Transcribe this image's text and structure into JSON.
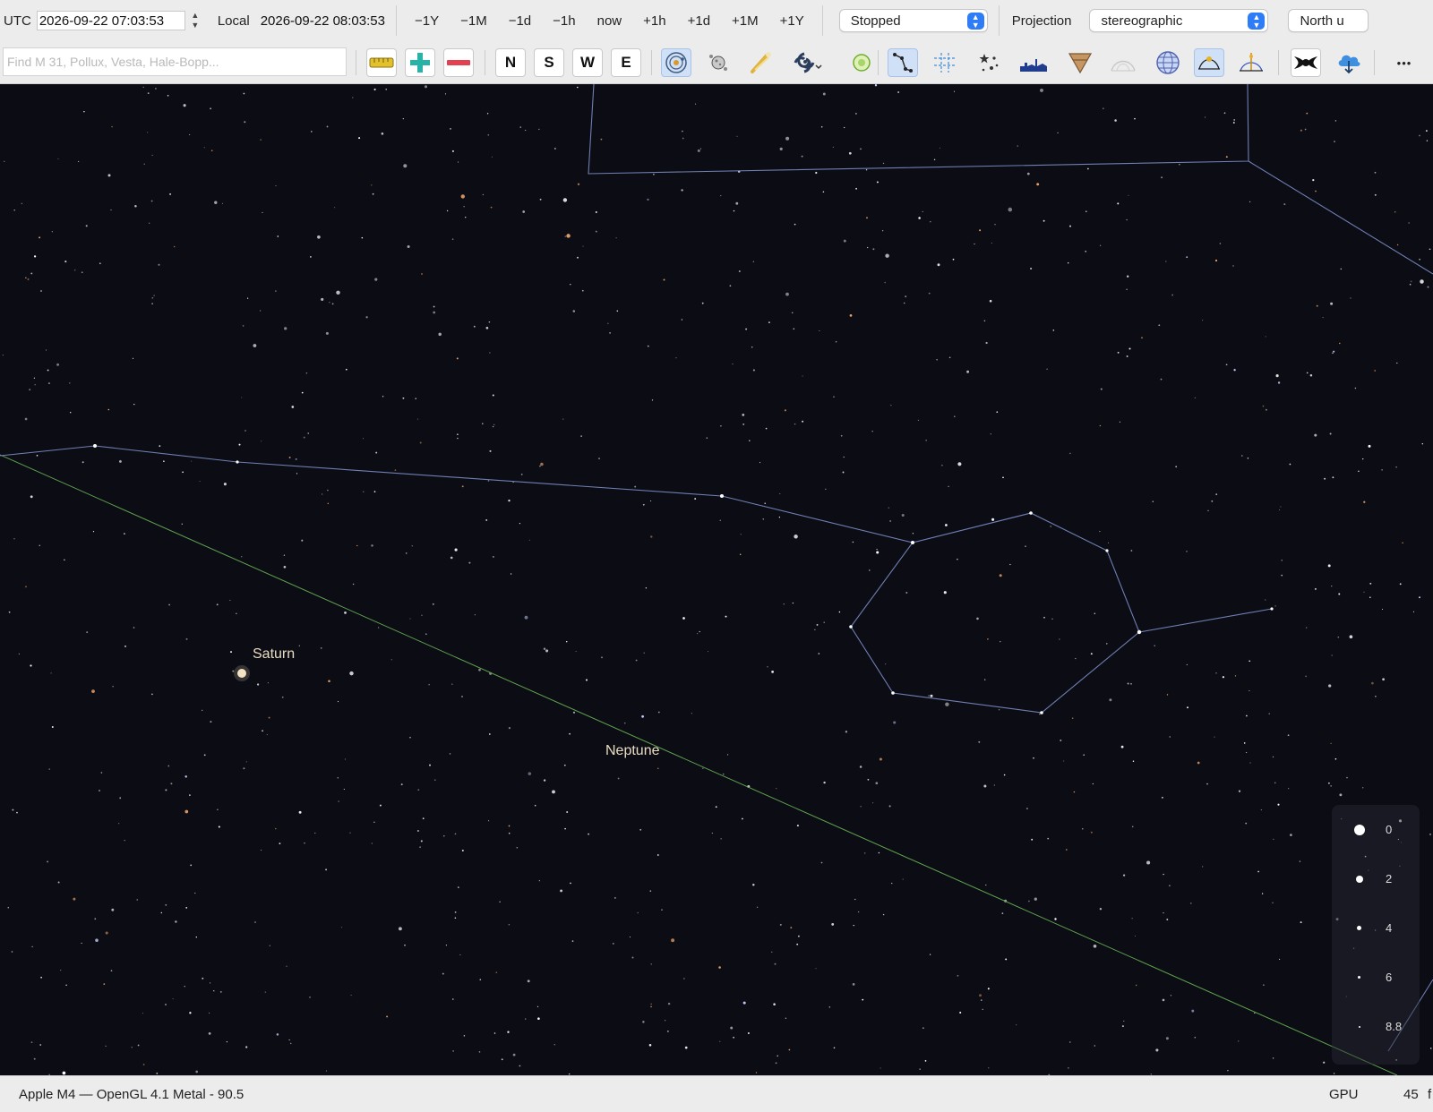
{
  "timebar": {
    "utc_label": "UTC",
    "utc_value": "2026-09-22 07:03:53",
    "local_label": "Local",
    "local_value": "2026-09-22 08:03:53",
    "steps": [
      "−1Y",
      "−1M",
      "−1d",
      "−1h",
      "now",
      "+1h",
      "+1d",
      "+1M",
      "+1Y"
    ],
    "status_select": "Stopped",
    "projection_label": "Projection",
    "projection_select": "stereographic",
    "orientation_select": "North u"
  },
  "toolbar": {
    "search_placeholder": "Find M 31, Pollux, Vesta, Hale-Bopp...",
    "directions": [
      "N",
      "S",
      "W",
      "E"
    ],
    "more_glyph": "•••",
    "icons": [
      "ruler-icon",
      "zoom-in-icon",
      "zoom-out-icon",
      "solar-system-icon",
      "moons-icon",
      "comet-icon",
      "galaxy-icon",
      "nebula-icon",
      "constellation-lines-icon",
      "crosshair-grid-icon",
      "star-field-icon",
      "horizon-icon",
      "ecliptic-icon",
      "atmosphere-icon",
      "globe-grid-icon",
      "sun-path-icon",
      "meridian-icon",
      "eclipse-icon",
      "cloud-download-icon",
      "more-icon"
    ],
    "accent_color": "#2f7df6"
  },
  "sky": {
    "planets": [
      {
        "name": "Saturn"
      },
      {
        "name": "Neptune"
      }
    ],
    "magnitude_legend": [
      "0",
      "2",
      "4",
      "6",
      "8.8"
    ],
    "constellation_line_color": "#6f7fb3",
    "ecliptic_color": "#5fa24e"
  },
  "statusbar": {
    "renderer": "Apple M4 — OpenGL 4.1 Metal - 90.5",
    "gpu_label": "GPU",
    "fps_value": "45",
    "fps_unit": "f"
  }
}
